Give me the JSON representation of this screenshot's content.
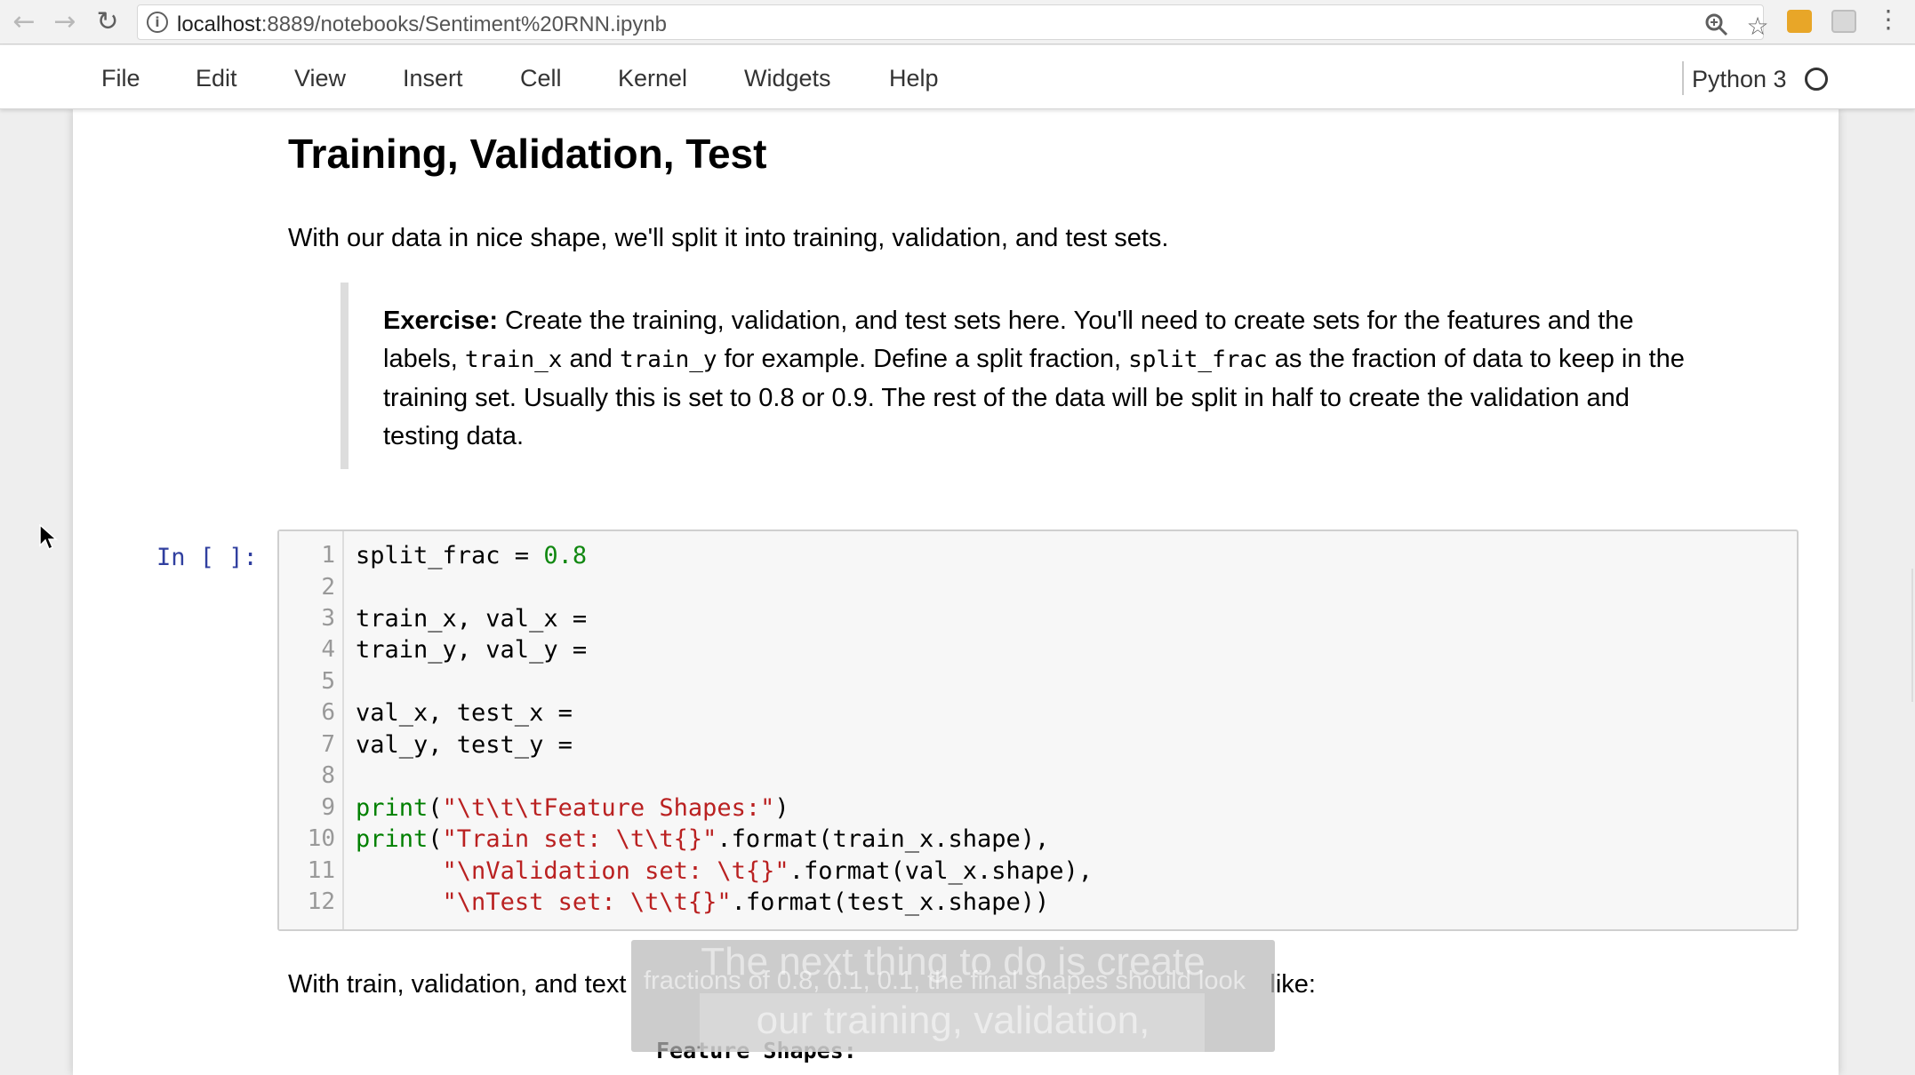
{
  "browser": {
    "back_icon": "arrow-left-icon",
    "forward_icon": "arrow-right-icon",
    "reload_icon": "reload-icon",
    "url_host": "localhost",
    "url_rest": ":8889/notebooks/Sentiment%20RNN.ipynb",
    "zoom_icon": "zoom-icon",
    "star_icon": "star-icon",
    "menu_icon": "vertical-dots-icon"
  },
  "menubar": {
    "items": [
      "File",
      "Edit",
      "View",
      "Insert",
      "Cell",
      "Kernel",
      "Widgets",
      "Help"
    ],
    "kernel_name": "Python 3"
  },
  "notebook": {
    "heading": "Training, Validation, Test",
    "intro": "With our data in nice shape, we'll split it into training, validation, and test sets.",
    "exercise": {
      "label": "Exercise:",
      "text_1": " Create the training, validation, and test sets here. You'll need to create sets for the features and the labels, ",
      "code_1": "train_x",
      "text_2": " and ",
      "code_2": "train_y",
      "text_3": " for example. Define a split fraction, ",
      "code_3": "split_frac",
      "text_4": " as the fraction of data to keep in the training set. Usually this is set to 0.8 or 0.9. The rest of the data will be split in half to create the validation and testing data."
    },
    "cell_prompt": "In [ ]:",
    "code": {
      "line_numbers": [
        "1",
        "2",
        "3",
        "4",
        "5",
        "6",
        "7",
        "8",
        "9",
        "10",
        "11",
        "12"
      ],
      "l1_a": "split_frac = ",
      "l1_num": "0.8",
      "l3": "train_x, val_x = ",
      "l4": "train_y, val_y = ",
      "l6": "val_x, test_x = ",
      "l7": "val_y, test_y = ",
      "l9_fn": "print",
      "l9_a": "(",
      "l9_str": "\"\\t\\t\\tFeature Shapes:\"",
      "l9_b": ")",
      "l10_fn": "print",
      "l10_a": "(",
      "l10_str": "\"Train set: \\t\\t{}\"",
      "l10_b": ".format(train_x.shape),",
      "l11_indent": "      ",
      "l11_str": "\"\\nValidation set: \\t{}\"",
      "l11_b": ".format(val_x.shape),",
      "l12_indent": "      ",
      "l12_str": "\"\\nTest set: \\t\\t{}\"",
      "l12_b": ".format(test_x.shape))"
    },
    "after_text_start": "With train, validation, and text",
    "after_text_end": "like:",
    "feature_shapes": "Feature Shapes:"
  },
  "caption": {
    "line_1": "The next thing to do is create",
    "line_2": "our training, validation,",
    "behind_text": "fractions of 0.8, 0.1, 0.1, the final shapes should look"
  },
  "colors": {
    "prompt": "#303f9f",
    "number": "#118811",
    "keyword": "#008000",
    "string": "#ba2121"
  }
}
